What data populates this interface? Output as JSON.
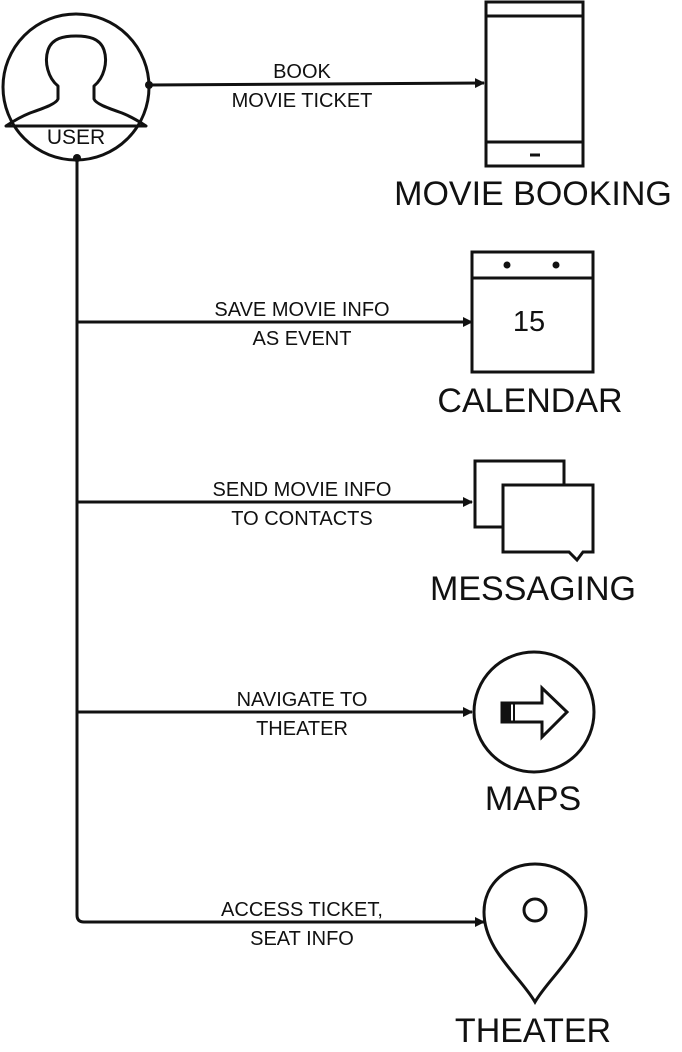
{
  "user": {
    "label": "USER"
  },
  "colors": {
    "stroke": "#111111",
    "background": "#ffffff"
  },
  "nodes": [
    {
      "id": "movie-booking",
      "label": "MOVIE BOOKING",
      "icon": "phone-icon"
    },
    {
      "id": "calendar",
      "label": "CALENDAR",
      "icon": "calendar-icon",
      "icon_text": "15"
    },
    {
      "id": "messaging",
      "label": "MESSAGING",
      "icon": "chat-bubbles-icon"
    },
    {
      "id": "maps",
      "label": "MAPS",
      "icon": "direction-arrow-icon"
    },
    {
      "id": "theater",
      "label": "THEATER",
      "icon": "location-pin-icon"
    }
  ],
  "edges": [
    {
      "to": "movie-booking",
      "label_lines": [
        "BOOK",
        "MOVIE TICKET"
      ]
    },
    {
      "to": "calendar",
      "label_lines": [
        "SAVE MOVIE INFO",
        "AS EVENT"
      ]
    },
    {
      "to": "messaging",
      "label_lines": [
        "SEND MOVIE INFO",
        "TO CONTACTS"
      ]
    },
    {
      "to": "maps",
      "label_lines": [
        "NAVIGATE TO",
        "THEATER"
      ]
    },
    {
      "to": "theater",
      "label_lines": [
        "ACCESS TICKET,",
        "SEAT INFO"
      ]
    }
  ]
}
